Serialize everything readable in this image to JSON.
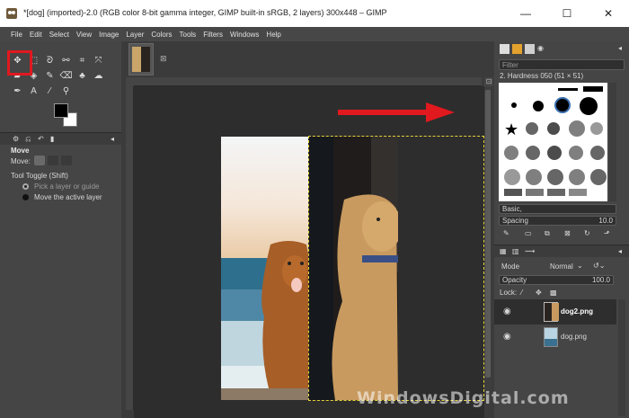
{
  "window": {
    "title": "*[dog] (imported)-2.0 (RGB color 8-bit gamma integer, GIMP built-in sRGB, 2 layers) 300x448 – GIMP",
    "minimize": "—",
    "maximize": "☐",
    "close": "✕"
  },
  "menu": [
    "File",
    "Edit",
    "Select",
    "View",
    "Image",
    "Layer",
    "Colors",
    "Tools",
    "Filters",
    "Windows",
    "Help"
  ],
  "tool_options": {
    "title": "Move",
    "move_label": "Move:",
    "tool_toggle": "Tool Toggle  (Shift)",
    "option1": "Pick a layer or guide",
    "option2": "Move the active layer"
  },
  "brushes": {
    "filter_placeholder": "Filter",
    "current": "2. Hardness 050 (51 × 51)",
    "tag": "Basic,",
    "spacing_label": "Spacing",
    "spacing_value": "10.0"
  },
  "layers": {
    "mode_label": "Mode",
    "mode_value": "Normal",
    "opacity_label": "Opacity",
    "opacity_value": "100.0",
    "lock_label": "Lock:",
    "items": [
      {
        "name": "dog2.png",
        "active": true
      },
      {
        "name": "dog.png",
        "active": false
      }
    ]
  },
  "watermark": "WindowsDigital.com",
  "colors": {
    "highlight": "#e0191f",
    "arrow": "#e0191f",
    "boundary": "#e6d23a"
  }
}
